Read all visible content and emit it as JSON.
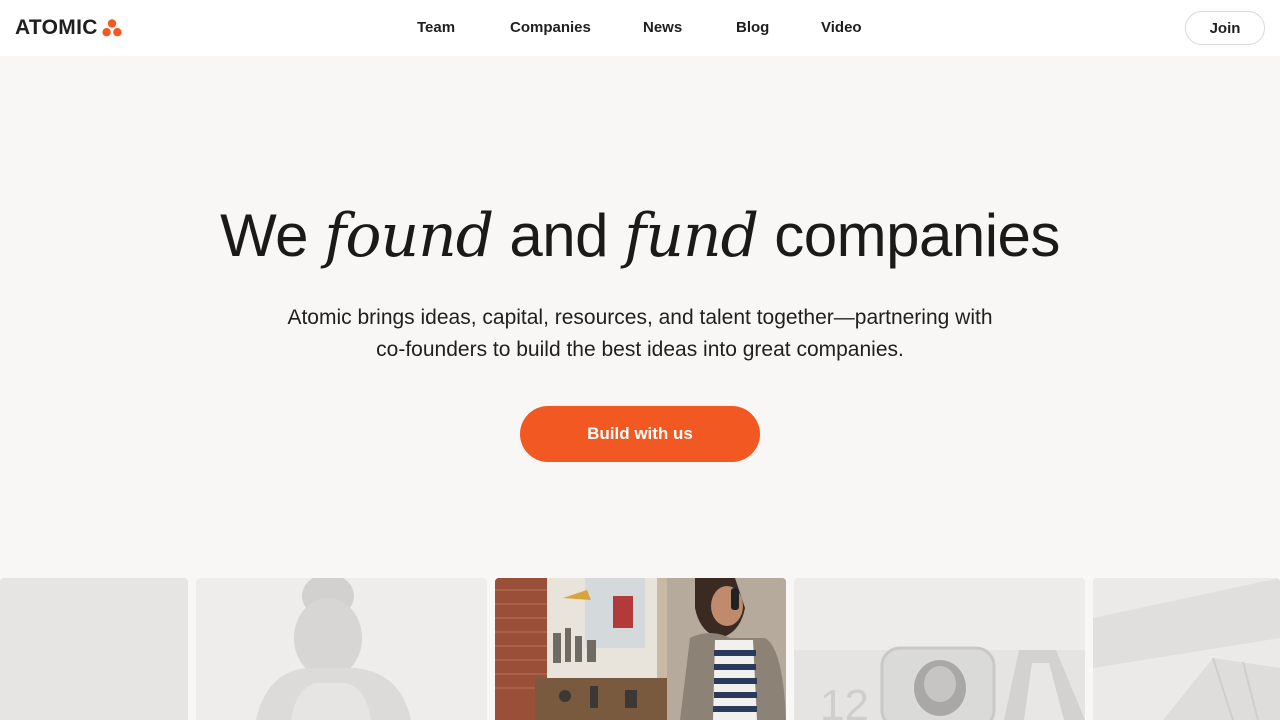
{
  "brand": {
    "name": "ATOMIC",
    "accent": "#f25822",
    "text_color": "#1f1f1f",
    "background": "#f8f7f5"
  },
  "nav": {
    "items": [
      {
        "label": "Team"
      },
      {
        "label": "Companies"
      },
      {
        "label": "News"
      },
      {
        "label": "Blog"
      },
      {
        "label": "Video"
      }
    ],
    "join_label": "Join"
  },
  "hero": {
    "title_part1": "We",
    "title_em1": "found",
    "title_part2": "and",
    "title_em2": "fund",
    "title_part3": "companies",
    "subtitle_line1": "Atomic brings ideas, capital, resources, and talent together—partnering with",
    "subtitle_line2": "co-founders to build the best ideas into great companies.",
    "cta_label": "Build with us"
  },
  "gallery": {
    "cards": [
      {
        "name": "gallery-card-1",
        "icon": "photo-placeholder",
        "active": false
      },
      {
        "name": "gallery-card-2",
        "icon": "person-photo",
        "active": false
      },
      {
        "name": "gallery-card-3",
        "icon": "person-phone-photo",
        "active": true
      },
      {
        "name": "gallery-card-4",
        "icon": "phone-app-photo",
        "active": false,
        "visible_text": "12"
      },
      {
        "name": "gallery-card-5",
        "icon": "interior-photo",
        "active": false
      }
    ]
  }
}
